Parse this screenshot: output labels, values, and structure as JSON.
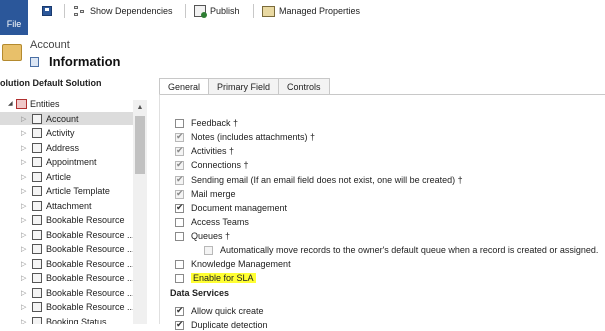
{
  "toolbar": {
    "file_label": "File",
    "show_dependencies": "Show Dependencies",
    "publish": "Publish",
    "managed_properties": "Managed Properties"
  },
  "entity": {
    "type_label": "Account",
    "name": "Information"
  },
  "solution": {
    "title": "olution Default Solution"
  },
  "tree": {
    "root_label": "Entities",
    "items": [
      {
        "label": "Account",
        "selected": true
      },
      {
        "label": "Activity"
      },
      {
        "label": "Address"
      },
      {
        "label": "Appointment"
      },
      {
        "label": "Article"
      },
      {
        "label": "Article Template"
      },
      {
        "label": "Attachment"
      },
      {
        "label": "Bookable Resource"
      },
      {
        "label": "Bookable Resource ..."
      },
      {
        "label": "Bookable Resource ..."
      },
      {
        "label": "Bookable Resource ..."
      },
      {
        "label": "Bookable Resource ..."
      },
      {
        "label": "Bookable Resource ..."
      },
      {
        "label": "Bookable Resource ..."
      },
      {
        "label": "Booking Status"
      }
    ]
  },
  "tabs": [
    "General",
    "Primary Field",
    "Controls"
  ],
  "options": [
    {
      "label": "Feedback †",
      "checked": false,
      "disabled": false
    },
    {
      "label": "Notes (includes attachments) †",
      "checked": true,
      "disabled": true
    },
    {
      "label": "Activities †",
      "checked": true,
      "disabled": true
    },
    {
      "label": "Connections †",
      "checked": true,
      "disabled": true
    },
    {
      "label": "Sending email (If an email field does not exist, one will be created) †",
      "checked": true,
      "disabled": true
    },
    {
      "label": "Mail merge",
      "checked": true,
      "disabled": true
    },
    {
      "label": "Document management",
      "checked": true,
      "disabled": false
    },
    {
      "label": "Access Teams",
      "checked": false,
      "disabled": false
    },
    {
      "label": "Queues †",
      "checked": false,
      "disabled": false
    },
    {
      "label": "Automatically move records to the owner's default queue when a record is created or assigned.",
      "checked": false,
      "disabled": true
    },
    {
      "label": "Knowledge Management",
      "checked": false,
      "disabled": false
    },
    {
      "label": "Enable for SLA",
      "checked": false,
      "disabled": false,
      "highlighted": true
    }
  ],
  "data_services": {
    "title": "Data Services",
    "options": [
      {
        "label": "Allow quick create",
        "checked": true
      },
      {
        "label": "Duplicate detection",
        "checked": true
      }
    ]
  },
  "colors": {
    "file_tab": "#2b579a",
    "highlight": "#ffff33",
    "selected_row": "#dcdcdc"
  }
}
